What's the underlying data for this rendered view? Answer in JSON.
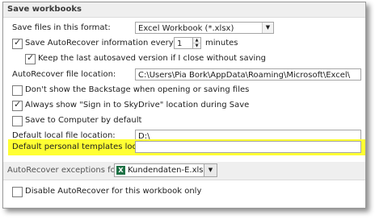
{
  "save_workbooks": {
    "header": "Save workbooks",
    "save_format_label": "Save files in this format:",
    "save_format_value": "Excel Workbook (*.xlsx)",
    "autorecover_label": "Save AutoRecover information every",
    "autorecover_checked": true,
    "autorecover_minutes": "1",
    "minutes_label": "minutes",
    "keep_last_label": "Keep the last autosaved version if I close without saving",
    "keep_last_checked": true,
    "ar_location_label": "AutoRecover file location:",
    "ar_location_value": "C:\\Users\\Pia Bork\\AppData\\Roaming\\Microsoft\\Excel\\",
    "backstage_label": "Don't show the Backstage when opening or saving files",
    "backstage_checked": false,
    "skydrive_label": "Always show \"Sign in to SkyDrive\" location during Save",
    "skydrive_checked": true,
    "save_computer_label": "Save to Computer by default",
    "save_computer_checked": false,
    "default_local_label": "Default local file location:",
    "default_local_value": "D:\\",
    "personal_templates_label": "Default personal templates location:",
    "personal_templates_value": ""
  },
  "autorecover_exceptions": {
    "header": "AutoRecover exceptions for:",
    "workbook_value": "Kundendaten-E.xlsx",
    "workbook_icon": "excel-icon",
    "disable_label": "Disable AutoRecover for this workbook only",
    "disable_checked": false
  },
  "colors": {
    "highlight": "#ffff33",
    "excel_green": "#1e7145"
  }
}
